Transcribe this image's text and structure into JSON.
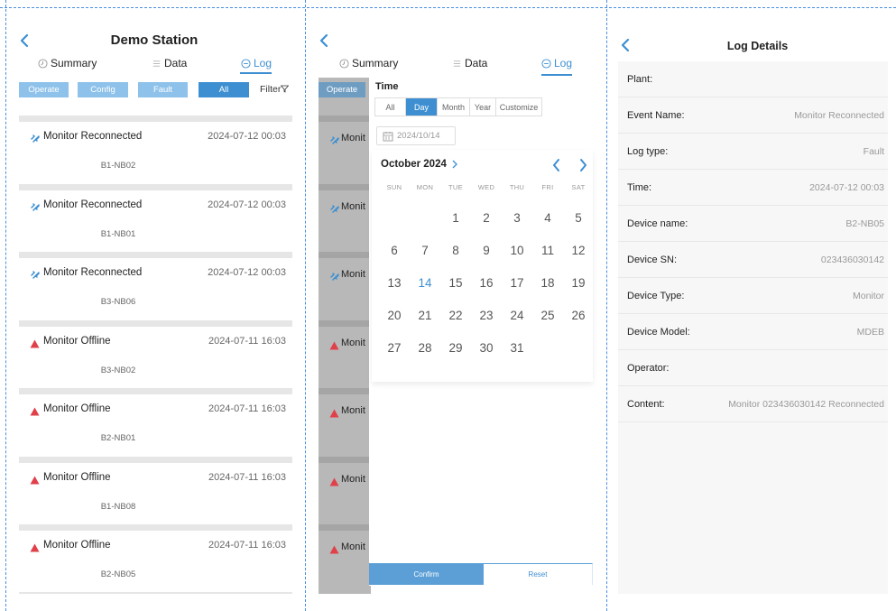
{
  "panel1": {
    "title": "Demo Station",
    "tabs": {
      "summary": "Summary",
      "data": "Data",
      "log": "Log"
    },
    "filters": {
      "operate": "Operate",
      "config": "Config",
      "fault": "Fault",
      "all": "All",
      "filter": "Filter"
    },
    "logs": [
      {
        "type": "reconnect",
        "name": "Monitor Reconnected",
        "time": "2024-07-12 00:03",
        "device": "B1-NB02"
      },
      {
        "type": "reconnect",
        "name": "Monitor Reconnected",
        "time": "2024-07-12 00:03",
        "device": "B1-NB01"
      },
      {
        "type": "reconnect",
        "name": "Monitor Reconnected",
        "time": "2024-07-12 00:03",
        "device": "B3-NB06"
      },
      {
        "type": "offline",
        "name": "Monitor Offline",
        "time": "2024-07-11 16:03",
        "device": "B3-NB02"
      },
      {
        "type": "offline",
        "name": "Monitor Offline",
        "time": "2024-07-11 16:03",
        "device": "B2-NB01"
      },
      {
        "type": "offline",
        "name": "Monitor Offline",
        "time": "2024-07-11 16:03",
        "device": "B1-NB08"
      },
      {
        "type": "offline",
        "name": "Monitor Offline",
        "time": "2024-07-11 16:03",
        "device": "B2-NB05"
      }
    ]
  },
  "panel2": {
    "tabs": {
      "summary": "Summary",
      "data": "Data",
      "log": "Log"
    },
    "bg_filter": "Operate",
    "bg_rows": [
      {
        "type": "reconnect",
        "name": "Monit"
      },
      {
        "type": "reconnect",
        "name": "Monit"
      },
      {
        "type": "reconnect",
        "name": "Monit"
      },
      {
        "type": "offline",
        "name": "Monit"
      },
      {
        "type": "offline",
        "name": "Monit"
      },
      {
        "type": "offline",
        "name": "Monit"
      },
      {
        "type": "offline",
        "name": "Monit"
      }
    ],
    "time_label": "Time",
    "segments": [
      "All",
      "Day",
      "Month",
      "Year",
      "Customize"
    ],
    "active_segment": "Day",
    "date_value": "2024/10/14",
    "calendar": {
      "month_title": "October 2024",
      "weekdays": [
        "SUN",
        "MON",
        "TUE",
        "WED",
        "THU",
        "FRI",
        "SAT"
      ],
      "first_weekday": 2,
      "days_in_month": 31,
      "selected_day": 14
    },
    "confirm_label": "Confirm",
    "reset_label": "Reset"
  },
  "panel3": {
    "title": "Log Details",
    "fields": [
      {
        "key": "Plant:",
        "value": ""
      },
      {
        "key": "Event Name:",
        "value": "Monitor Reconnected"
      },
      {
        "key": "Log type:",
        "value": "Fault"
      },
      {
        "key": "Time:",
        "value": "2024-07-12 00:03"
      },
      {
        "key": "Device name:",
        "value": "B2-NB05"
      },
      {
        "key": "Device SN:",
        "value": "023436030142"
      },
      {
        "key": "Device Type:",
        "value": "Monitor"
      },
      {
        "key": "Device Model:",
        "value": "MDEB"
      },
      {
        "key": "Operator:",
        "value": ""
      },
      {
        "key": "Content:",
        "value": "Monitor 023436030142 Reconnected"
      }
    ]
  },
  "colors": {
    "accent": "#3d8fd1",
    "accent_light": "#8ec2ea",
    "offline": "#e0404a",
    "reconnect": "#3d8fd1",
    "muted": "#999999"
  },
  "icons": {
    "back": "chevron-left-icon",
    "reconnect": "reconnect-icon",
    "offline": "warning-triangle-icon",
    "calendar": "calendar-icon",
    "filter": "filter-funnel-icon"
  }
}
